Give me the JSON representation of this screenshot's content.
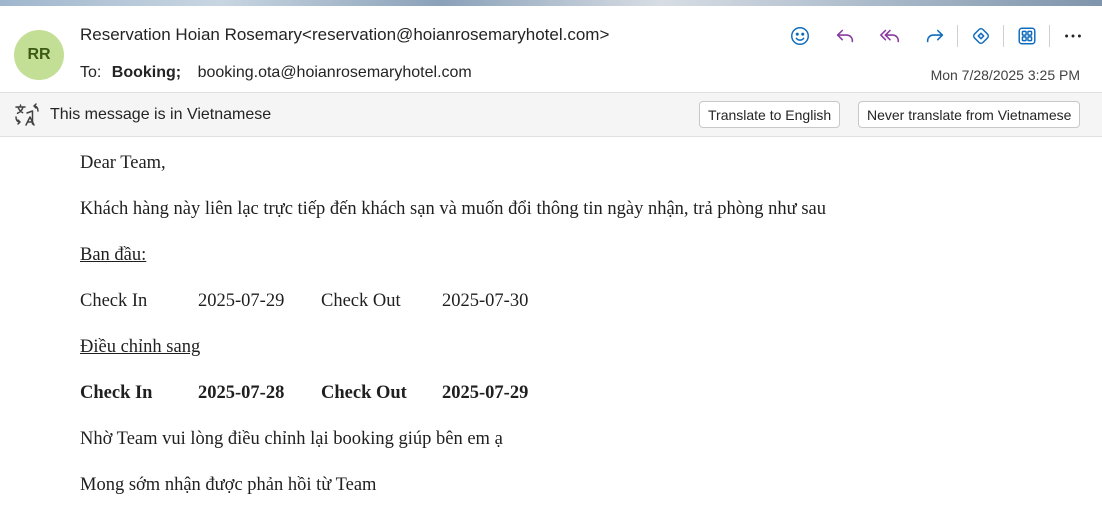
{
  "colors": {
    "avatar_bg": "#c3df95",
    "accent": "#0f6cbd",
    "reply_purple": "#8a3b9f"
  },
  "header": {
    "avatar_initials": "RR",
    "sender": "Reservation Hoian Rosemary<reservation@hoianrosemaryhotel.com>",
    "to_prefix": "To:",
    "to_name": "Booking;",
    "to_email": "booking.ota@hoianrosemaryhotel.com",
    "date": "Mon 7/28/2025 3:25 PM"
  },
  "toolbar": {
    "icons": [
      "emoji-icon",
      "reply-icon",
      "reply-all-icon",
      "forward-icon",
      "copilot-icon",
      "apps-icon",
      "more-icon"
    ]
  },
  "translate_bar": {
    "message": "This message is in Vietnamese",
    "translate_button": "Translate to English",
    "never_button": "Never translate from Vietnamese"
  },
  "body": {
    "greeting": "Dear Team,",
    "line1": "Khách hàng này liên lạc trực tiếp đến khách sạn và muốn đổi thông tin ngày nhận, trả phòng như sau",
    "original_heading": "Ban đầu:",
    "original": {
      "checkin_label": "Check In",
      "checkin": "2025-07-29",
      "checkout_label": "Check Out",
      "checkout": "2025-07-30"
    },
    "adjust_heading": "Điều chỉnh sang",
    "adjusted": {
      "checkin_label": "Check In",
      "checkin": "2025-07-28",
      "checkout_label": "Check Out",
      "checkout": "2025-07-29"
    },
    "line2": "Nhờ Team vui lòng điều chỉnh lại booking giúp bên em ạ",
    "line3": "Mong sớm nhận được phản hồi từ Team"
  }
}
